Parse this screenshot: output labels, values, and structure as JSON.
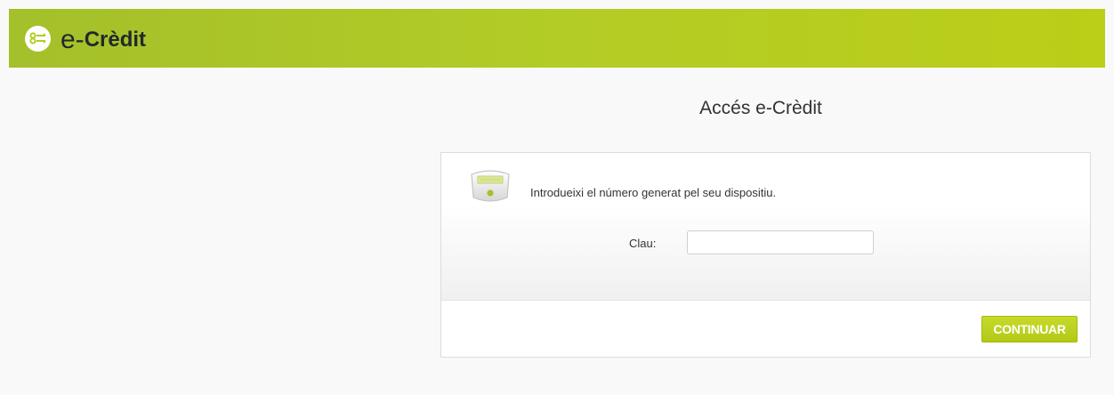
{
  "header": {
    "logo_prefix": "e-",
    "logo_brand": "Crèdit",
    "brand_color": "#b3cc26"
  },
  "main": {
    "title": "Accés e-Crèdit",
    "instruction": "Introdueixi el número generat pel seu dispositiu.",
    "clau_label": "Clau:",
    "clau_value": "",
    "clau_placeholder": "",
    "continue_label": "CONTINUAR",
    "device_icon": "token-device-icon"
  }
}
